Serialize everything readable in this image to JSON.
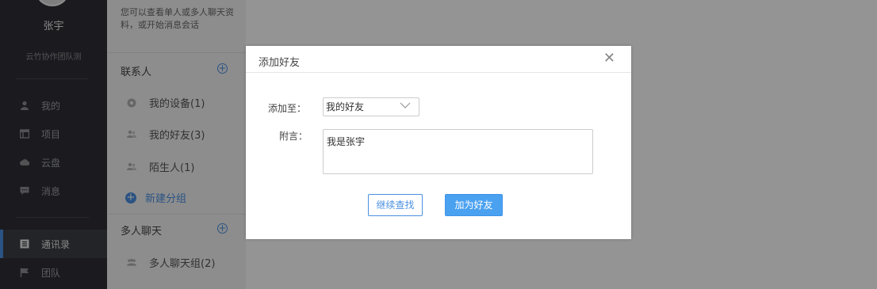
{
  "sidebar": {
    "username": "张宇",
    "team": "云竹协作团队测",
    "items": [
      {
        "label": "我的",
        "icon": "user-icon"
      },
      {
        "label": "项目",
        "icon": "project-icon"
      },
      {
        "label": "云盘",
        "icon": "cloud-icon"
      },
      {
        "label": "消息",
        "icon": "message-icon"
      },
      {
        "label": "通讯录",
        "icon": "contacts-icon",
        "active": true
      },
      {
        "label": "团队",
        "icon": "flag-icon"
      }
    ]
  },
  "contacts": {
    "intro": "您可以查看单人或多人聊天资料，或开始消息会话",
    "section_contacts": "联系人",
    "rows": [
      {
        "label": "我的设备(1)",
        "icon": "device-icon"
      },
      {
        "label": "我的好友(3)",
        "icon": "friends-icon"
      },
      {
        "label": "陌生人(1)",
        "icon": "stranger-icon"
      }
    ],
    "new_group": "新建分组",
    "section_group_chat": "多人聊天",
    "group_rows": [
      {
        "label": "多人聊天组(2)",
        "icon": "group-chat-icon"
      }
    ]
  },
  "dialog": {
    "title": "添加好友",
    "add_to_label": "添加至：",
    "add_to_value": "我的好友",
    "message_label": "附言：",
    "message_value": "我是张宇",
    "continue_button": "继续查找",
    "add_button": "加为好友"
  },
  "colors": {
    "accent": "#4a90e2",
    "primary_button": "#4aa1f0",
    "nav_bg": "#2f3036",
    "overlay": "rgba(0,0,0,0.42)"
  }
}
